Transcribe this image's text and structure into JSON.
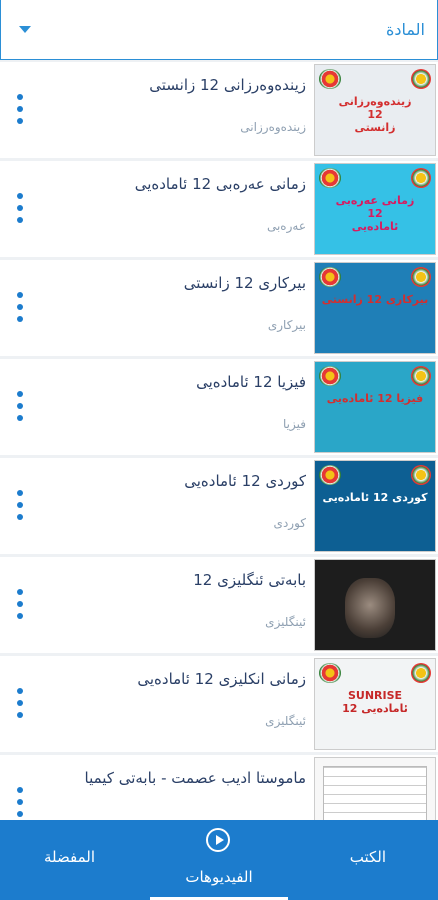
{
  "subject_dropdown": {
    "label": "المادة"
  },
  "videos": [
    {
      "title": "زیندەوەرزانی 12 زانستی",
      "category": "زیندەوەرزانی",
      "thumb_caption": "زیندەوەرزانی\n12\nزانستی",
      "thumb_bg": "#e9edf1",
      "thumb_fg": "#d32f2f"
    },
    {
      "title": "زمانی عەرەبی 12 ئامادەیی",
      "category": "عەرەبی",
      "thumb_caption": "زمانی عەرەبی\n12\nئامادەیی",
      "thumb_bg": "#35c1e6",
      "thumb_fg": "#d81b60"
    },
    {
      "title": "بیرکاری 12 زانستی",
      "category": "بیرکاری",
      "thumb_caption": "بیرکاری 12 زانستی",
      "thumb_bg": "#1f7fb7",
      "thumb_fg": "#d32f2f"
    },
    {
      "title": "فیزیا 12 ئامادەیی",
      "category": "فیزیا",
      "thumb_caption": "فیزیا 12 ئامادەیی",
      "thumb_bg": "#2aa6c8",
      "thumb_fg": "#d32f2f"
    },
    {
      "title": "کوردی 12 ئامادەیی",
      "category": "کوردی",
      "thumb_caption": "کوردی 12 ئامادەیی",
      "thumb_bg": "#0d5f93",
      "thumb_fg": "#ffffff"
    },
    {
      "title": "بابەتی ئنگلیزی 12",
      "category": "ئینگلیزی",
      "thumb_caption": "",
      "thumb_bg": "#1d1d1d",
      "thumb_fg": "#ffffff"
    },
    {
      "title": "زمانی انکلیزی 12 ئامادەیی",
      "category": "ئینگلیزی",
      "thumb_caption": "SUNRISE\n12 ئامادەیی",
      "thumb_bg": "#f2f4f5",
      "thumb_fg": "#c62828"
    },
    {
      "title": "ماموستا ادیب عصمت - بابەتی کیمیا",
      "category": "",
      "thumb_caption": "",
      "thumb_bg": "#f7f7f7",
      "thumb_fg": "#333333"
    }
  ],
  "bottom_nav": {
    "books": "الكتب",
    "videos": "الفيديوهات",
    "favorites": "المفضلة"
  },
  "colors": {
    "accent": "#1c7ccd",
    "title": "#2a3f66",
    "muted": "#8fa0b2"
  }
}
